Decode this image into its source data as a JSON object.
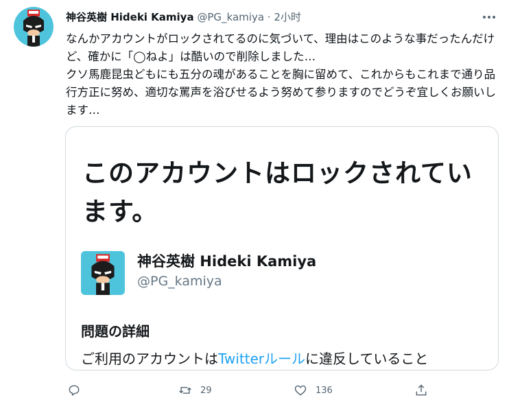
{
  "tweet": {
    "display_name": "神谷英樹 Hideki Kamiya",
    "handle": "@PG_kamiya",
    "separator": "·",
    "time": "2小时",
    "text": "なんかアカウントがロックされてるのに気づいて、理由はこのような事だったんだけど、確かに「◯ねよ」は酷いので削除しました…\nクソ馬鹿昆虫どもにも五分の魂があることを胸に留めて、これからもこれまで通り品行方正に努め、適切な罵声を浴びせるよう努めて参りますのでどうぞ宜しくお願いします…",
    "more_icon": "more-horizontal-icon",
    "avatar_icon": "cartoon-avatar-icon"
  },
  "card": {
    "title": "このアカウントはロックされています。",
    "name": "神谷英樹 Hideki Kamiya",
    "handle": "@PG_kamiya",
    "section_title": "問題の詳細",
    "body_prefix": "ご利用のアカウントは",
    "body_link": "Twitterルール",
    "body_suffix": "に違反していること"
  },
  "actions": {
    "reply_icon": "reply-icon",
    "retweet_icon": "retweet-icon",
    "retweet_count": "29",
    "like_icon": "heart-icon",
    "like_count": "136",
    "share_icon": "share-icon"
  },
  "colors": {
    "accent": "#1da1f2",
    "text": "#0f1419",
    "secondary": "#536471",
    "border": "#cfd9de",
    "avatar_bg": "#4ec4dc"
  }
}
